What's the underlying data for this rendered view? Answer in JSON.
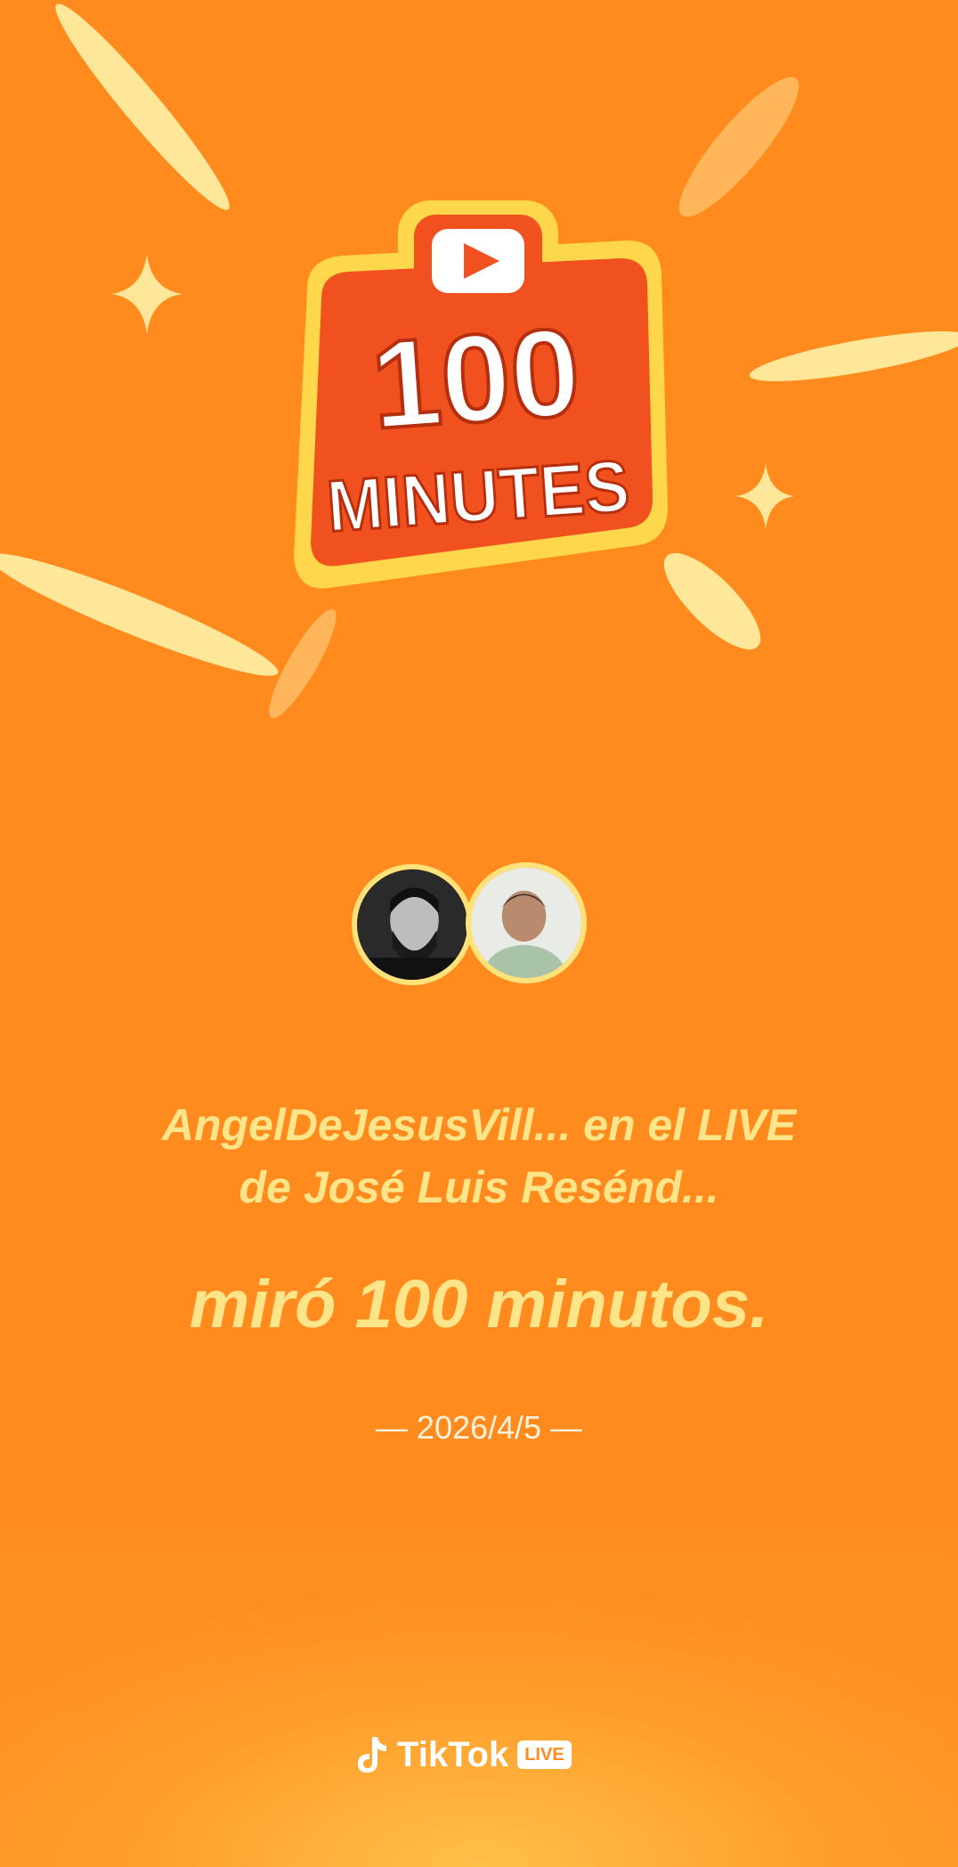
{
  "badge": {
    "number": "100",
    "word": "MINUTES"
  },
  "headline": {
    "line1": "AngelDeJesusVill... en el LIVE",
    "line2": "de José Luis Resénd..."
  },
  "main_text": "miró 100 minutos.",
  "date": "— 2026/4/5 —",
  "brand": {
    "name": "TikTok",
    "tag": "LIVE"
  },
  "icons": {
    "logo": "tiktok-note-icon",
    "badge_play": "play-icon"
  },
  "colors": {
    "background": "#ff8a1e",
    "accent_text": "#ffe58a",
    "badge_red": "#f1511f",
    "badge_yellow": "#ffd74a"
  }
}
